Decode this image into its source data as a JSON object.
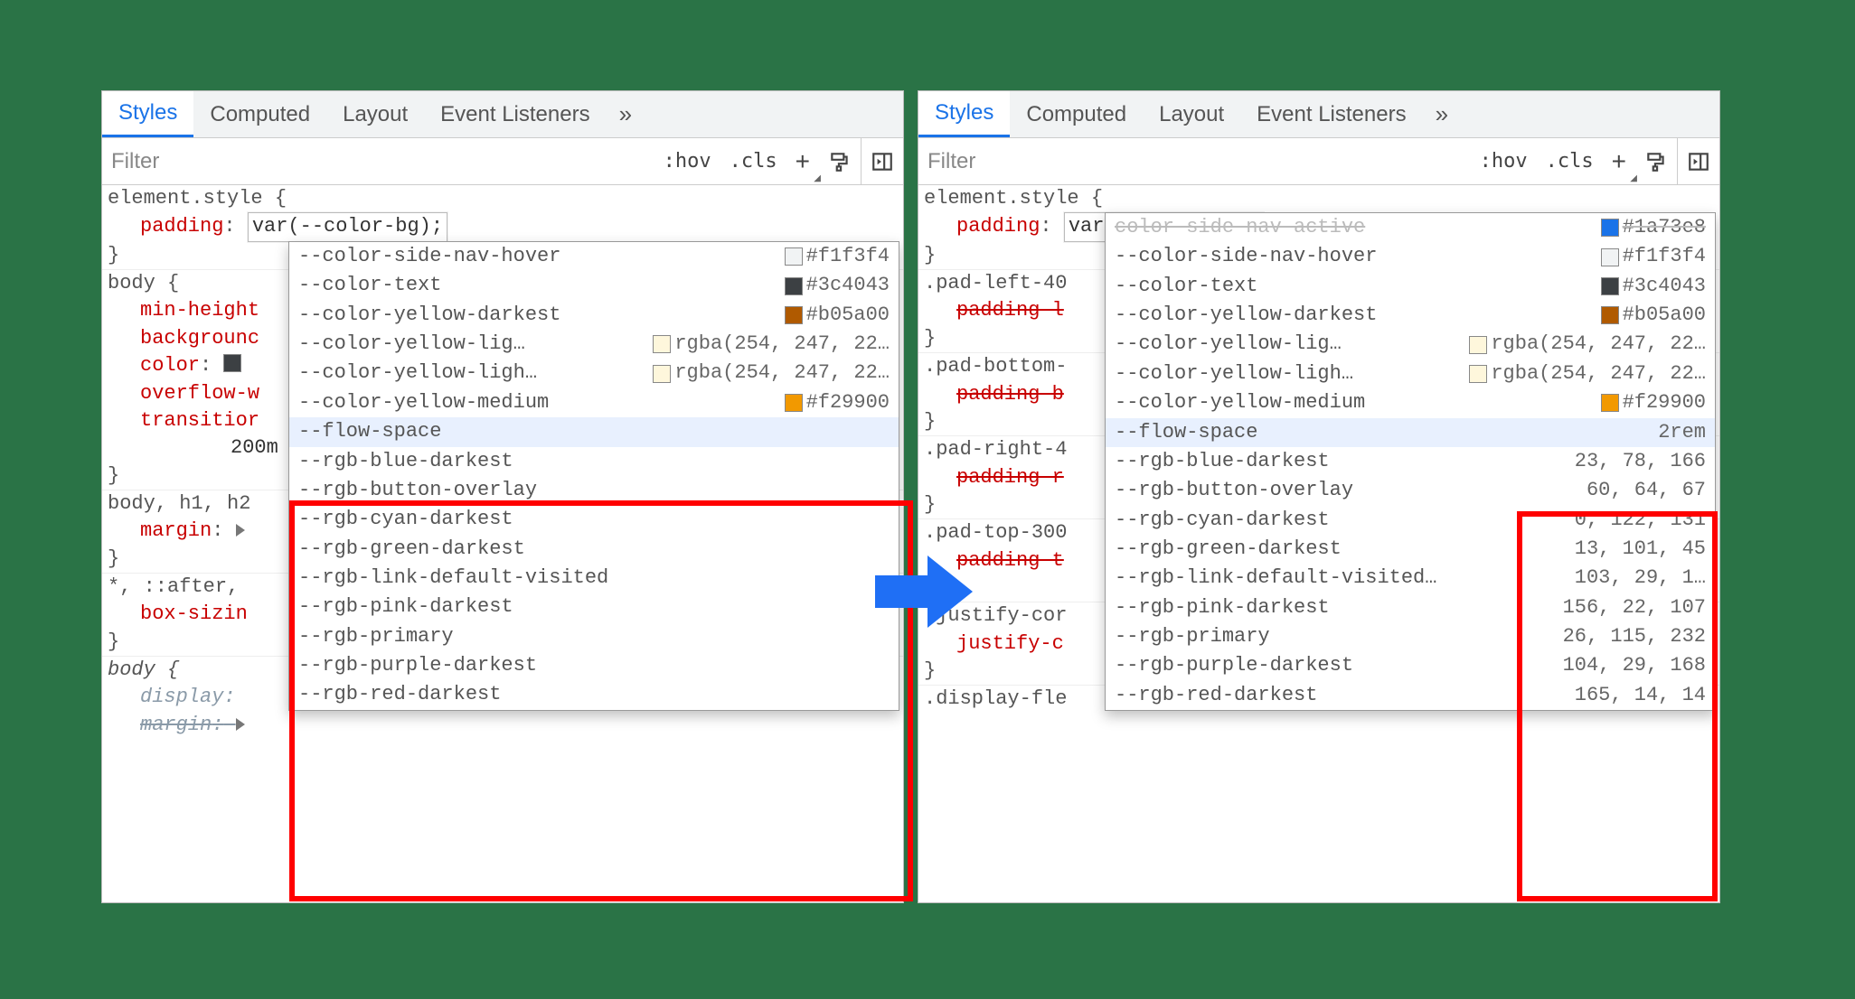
{
  "tabs": {
    "styles": "Styles",
    "computed": "Computed",
    "layout": "Layout",
    "listeners": "Event Listeners",
    "more": "»"
  },
  "filter": {
    "placeholder": "Filter",
    "hov": ":hov",
    "cls": ".cls",
    "plus": "+"
  },
  "element_style": {
    "selector": "element.style {",
    "prop": "padding",
    "value_edit": "var(--color-bg);",
    "close": "}"
  },
  "left": {
    "rules": [
      {
        "sel": "body {",
        "props": [
          {
            "name": "min-height"
          },
          {
            "name": "backgrounc"
          },
          {
            "name": "color",
            "after_swatch": true
          },
          {
            "name": "overflow-w"
          },
          {
            "name": "transitior"
          }
        ],
        "extra_line": "200m",
        "close": "}"
      },
      {
        "sel": "body, h1, h2",
        "props": [
          {
            "name": "margin",
            "disclose": true
          }
        ],
        "close": "}"
      },
      {
        "sel": "*, ::after,",
        "props": [
          {
            "name": "box-sizin"
          }
        ],
        "close": "}"
      },
      {
        "sel": "body {",
        "italic": true,
        "props": [
          {
            "name": "display",
            "italic": true
          },
          {
            "name": "margin",
            "struck_italic": true,
            "disclose": true
          }
        ]
      }
    ]
  },
  "right": {
    "rules": [
      {
        "sel": ".pad-left-40",
        "props": [
          {
            "name": "padding-l",
            "struck": true
          }
        ],
        "close": "}"
      },
      {
        "sel": ".pad-bottom-",
        "props": [
          {
            "name": "padding-b",
            "struck": true
          }
        ],
        "close": "}"
      },
      {
        "sel": ".pad-right-4",
        "props": [
          {
            "name": "padding-r",
            "struck": true
          }
        ],
        "close": "}"
      },
      {
        "sel": ".pad-top-300",
        "props": [
          {
            "name": "padding-t",
            "struck": true
          }
        ],
        "close": "}"
      },
      {
        "sel": ".justify-cor",
        "props": [
          {
            "name": "justify-c"
          }
        ],
        "close": "}"
      },
      {
        "sel": ".display-fle"
      }
    ]
  },
  "popup_colors": [
    {
      "name": "--color-side-nav-hover",
      "swatch": "#f1f3f4",
      "value": "#f1f3f4"
    },
    {
      "name": "--color-text",
      "swatch": "#3c4043",
      "value": "#3c4043"
    },
    {
      "name": "--color-yellow-darkest",
      "swatch": "#b05a00",
      "value": "#b05a00"
    },
    {
      "name": "--color-yellow-lig…",
      "swatch": "rgba(254,247,220,1)",
      "value": "rgba(254, 247, 22…"
    },
    {
      "name": "--color-yellow-ligh…",
      "swatch": "rgba(254,247,220,1)",
      "value": "rgba(254, 247, 22…"
    },
    {
      "name": "--color-yellow-medium",
      "swatch": "#f29900",
      "value": "#f29900"
    }
  ],
  "popup_vars_left": [
    {
      "name": "--flow-space",
      "hl": true
    },
    {
      "name": "--rgb-blue-darkest"
    },
    {
      "name": "--rgb-button-overlay"
    },
    {
      "name": "--rgb-cyan-darkest"
    },
    {
      "name": "--rgb-green-darkest"
    },
    {
      "name": "--rgb-link-default-visited"
    },
    {
      "name": "--rgb-pink-darkest"
    },
    {
      "name": "--rgb-primary"
    },
    {
      "name": "--rgb-purple-darkest"
    },
    {
      "name": "--rgb-red-darkest"
    }
  ],
  "popup_colors_right_extra": {
    "top_cut": {
      "name": "color side nav active",
      "swatch": "#1a73e8",
      "value": "#1a73e8"
    }
  },
  "popup_vars_right": [
    {
      "name": "--flow-space",
      "value": "2rem",
      "hl": true
    },
    {
      "name": "--rgb-blue-darkest",
      "value": "23, 78, 166"
    },
    {
      "name": "--rgb-button-overlay",
      "value": "60, 64, 67"
    },
    {
      "name": "--rgb-cyan-darkest",
      "value": "0, 122, 131"
    },
    {
      "name": "--rgb-green-darkest",
      "value": "13, 101, 45"
    },
    {
      "name": "--rgb-link-default-visited…",
      "value": "103, 29, 1…"
    },
    {
      "name": "--rgb-pink-darkest",
      "value": "156, 22, 107"
    },
    {
      "name": "--rgb-primary",
      "value": "26, 115, 232"
    },
    {
      "name": "--rgb-purple-darkest",
      "value": "104, 29, 168"
    },
    {
      "name": "--rgb-red-darkest",
      "value": "165, 14, 14"
    }
  ]
}
